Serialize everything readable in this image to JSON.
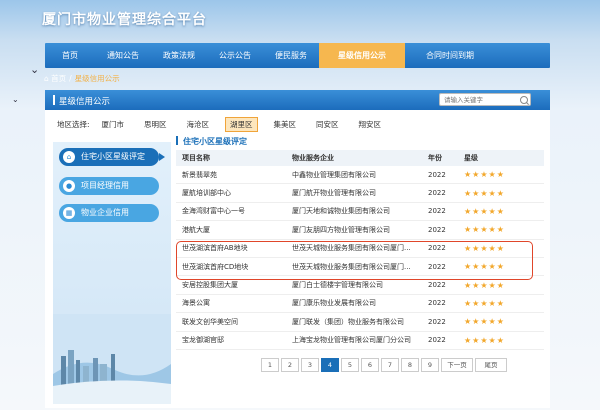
{
  "site": {
    "title": "厦门市物业管理综合平台"
  },
  "nav": {
    "items": [
      {
        "label": "首页",
        "w": 50
      },
      {
        "label": "通知公告",
        "w": 56
      },
      {
        "label": "政策法规",
        "w": 56
      },
      {
        "label": "公示公告",
        "w": 56
      },
      {
        "label": "便民服务",
        "w": 56
      },
      {
        "label": "星级信用公示",
        "w": 86,
        "active": true
      },
      {
        "label": "合同时间到期",
        "w": 90
      }
    ]
  },
  "breadcrumb": {
    "home": "首页",
    "sep": "/",
    "current": "星级信用公示"
  },
  "panel": {
    "title": "星级信用公示",
    "search_placeholder": "请输入关键字"
  },
  "district": {
    "label": "地区选择:",
    "items": [
      "厦门市",
      "思明区",
      "海沧区",
      "湖里区",
      "集美区",
      "同安区",
      "翔安区"
    ],
    "active": "湖里区"
  },
  "sidebar": {
    "items": [
      "住宅小区星级评定",
      "项目经理信用",
      "物业企业信用"
    ]
  },
  "section": {
    "title": "住宅小区星级评定"
  },
  "table": {
    "headers": [
      "项目名称",
      "物业服务企业",
      "年份",
      "星级"
    ],
    "rows": [
      {
        "name": "新景翡翠苑",
        "company": "中鑫物业管理集团有限公司",
        "year": "2022",
        "stars": "★★★★★"
      },
      {
        "name": "厦航培训部中心",
        "company": "厦门航开物业管理有限公司",
        "year": "2022",
        "stars": "★★★★★"
      },
      {
        "name": "金海湾财富中心一号",
        "company": "厦门天地和诚物业集团有限公司",
        "year": "2022",
        "stars": "★★★★★"
      },
      {
        "name": "港航大厦",
        "company": "厦门友朋四方物业管理有限公司",
        "year": "2022",
        "stars": "★★★★★"
      },
      {
        "name": "世茂湖滨首府AB地块",
        "company": "世茂天城物业服务集团有限公司厦门...",
        "year": "2022",
        "stars": "★★★★★"
      },
      {
        "name": "世茂湖滨首府CD地块",
        "company": "世茂天城物业服务集团有限公司厦门...",
        "year": "2022",
        "stars": "★★★★★"
      },
      {
        "name": "安居控股集团大厦",
        "company": "厦门白士德楼宇管理有限公司",
        "year": "2022",
        "stars": "★★★★★"
      },
      {
        "name": "海景公寓",
        "company": "厦门康乐物业发展有限公司",
        "year": "2022",
        "stars": "★★★★★"
      },
      {
        "name": "联发文创华美空间",
        "company": "厦门联发（集团）物业服务有限公司",
        "year": "2022",
        "stars": "★★★★★"
      },
      {
        "name": "宝龙御湖官邸",
        "company": "上海宝龙物业管理有限公司厦门分公司",
        "year": "2022",
        "stars": "★★★★★"
      }
    ]
  },
  "pager": {
    "pages": [
      "1",
      "2",
      "3",
      "4",
      "5",
      "6",
      "7",
      "8",
      "9"
    ],
    "current": "4",
    "next": "下一页",
    "last": "尾页"
  }
}
